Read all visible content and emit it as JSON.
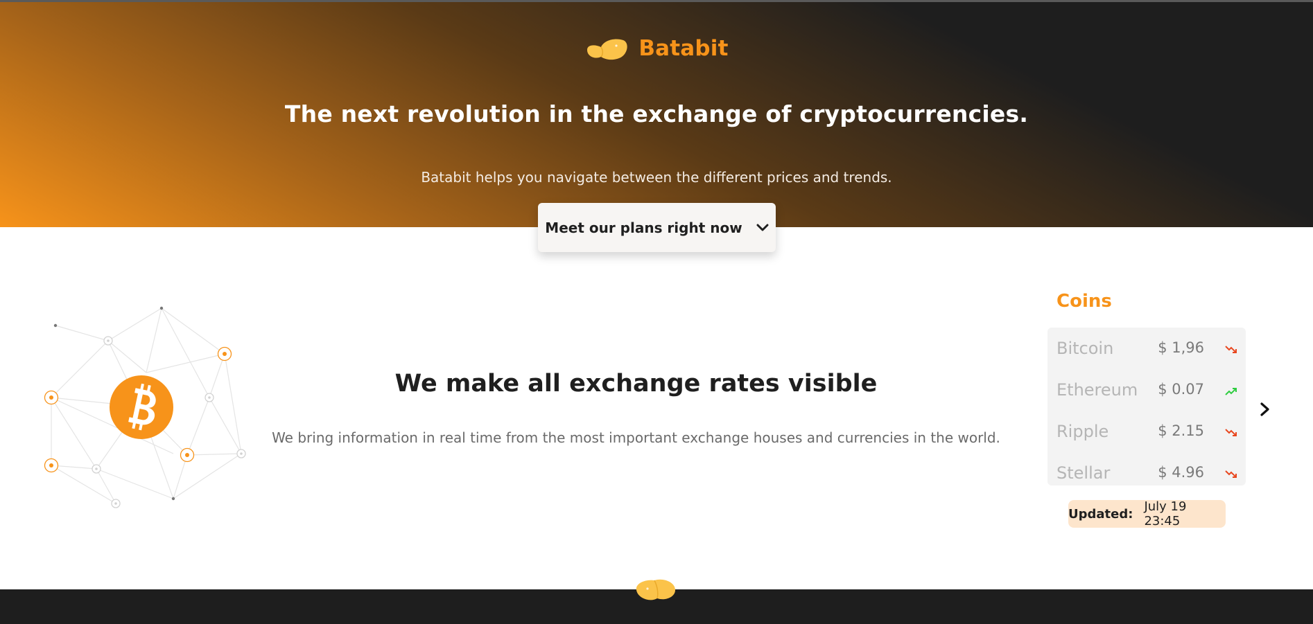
{
  "header": {
    "brand_name": "Batabit",
    "logo_icon": "batabit-logo-icon",
    "title": "The next revolution in the exchange of cryptocurrencies.",
    "subtitle": "Batabit helps you navigate between the different prices and trends.",
    "cta_label": "Meet our plans right now",
    "cta_icon": "chevron-down-icon"
  },
  "main": {
    "illustration_icon": "bitcoin-network-icon",
    "title": "We make all exchange rates visible",
    "description": "We bring information in real time from the most important exchange houses and currencies in the world."
  },
  "coins": {
    "title": "Coins",
    "rows": [
      {
        "name": "Bitcoin",
        "price": "$ 1,96",
        "trend": "down"
      },
      {
        "name": "Ethereum",
        "price": "$ 0.07",
        "trend": "up"
      },
      {
        "name": "Ripple",
        "price": "$ 2.15",
        "trend": "down"
      },
      {
        "name": "Stellar",
        "price": "$ 4.96",
        "trend": "down"
      }
    ],
    "next_icon": "chevron-right-icon",
    "updated_label": "Updated:",
    "updated_value": "July 19 23:45"
  },
  "colors": {
    "accent": "#f7931a",
    "dark": "#1e1e1e",
    "trend_up": "#2ecc40",
    "trend_down": "#e8461e",
    "updated_bg": "#fde5cc"
  }
}
